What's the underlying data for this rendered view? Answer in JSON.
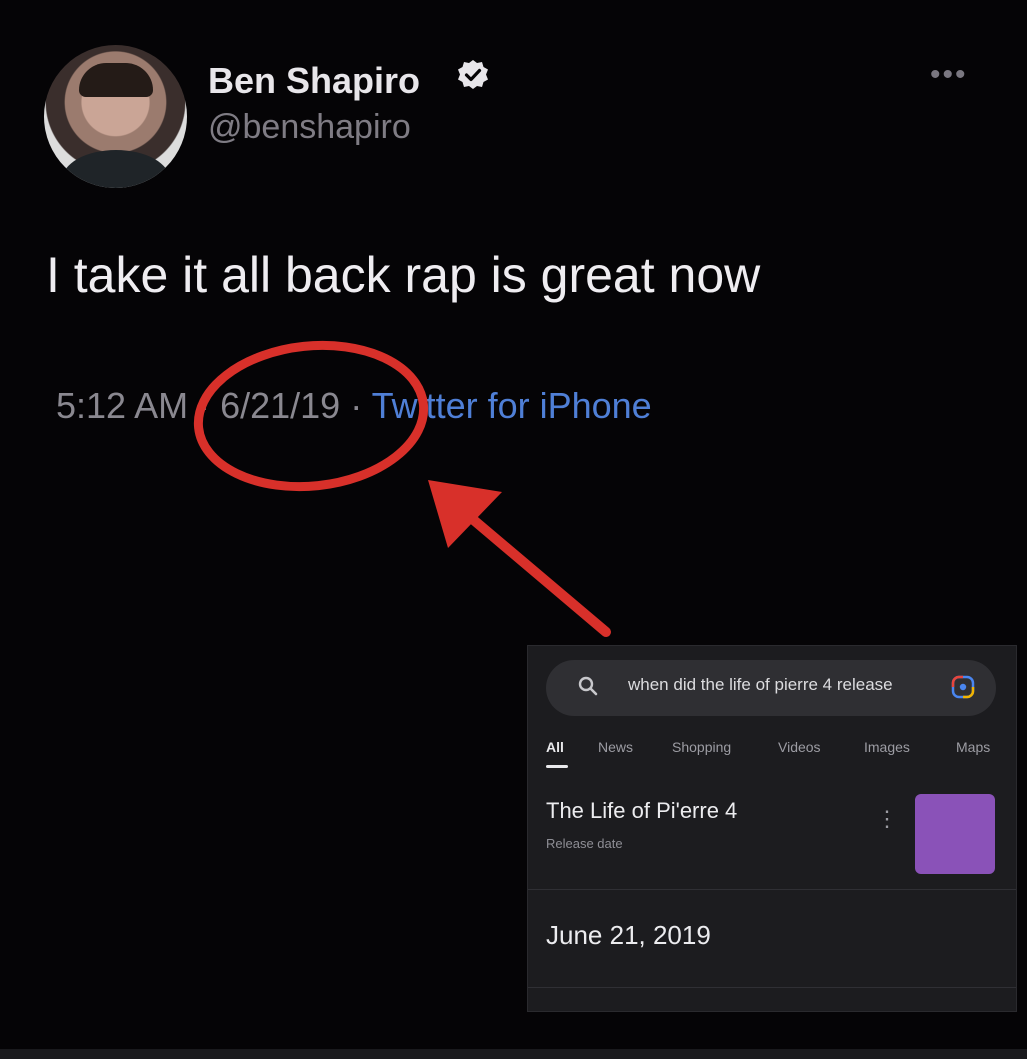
{
  "tweet": {
    "name": "Ben Shapiro",
    "handle": "@benshapiro",
    "text": "I take it all back rap is great now",
    "time": "5:12 AM",
    "date_sep": " · ",
    "date": "6/21/19",
    "source_sep": " · ",
    "source": "Twitter for iPhone",
    "more": "•••"
  },
  "google": {
    "query": "when did the life of pierre 4 release",
    "tabs": [
      "All",
      "News",
      "Shopping",
      "Videos",
      "Images",
      "Maps"
    ],
    "title": "The Life of Pi'erre 4",
    "subtitle": "Release date",
    "date": "June 21, 2019",
    "kebab": "⋮"
  },
  "colors": {
    "annotation_red": "#d8302a",
    "link_blue": "#4f7fd6",
    "thumb_purple": "#8a52b8"
  }
}
